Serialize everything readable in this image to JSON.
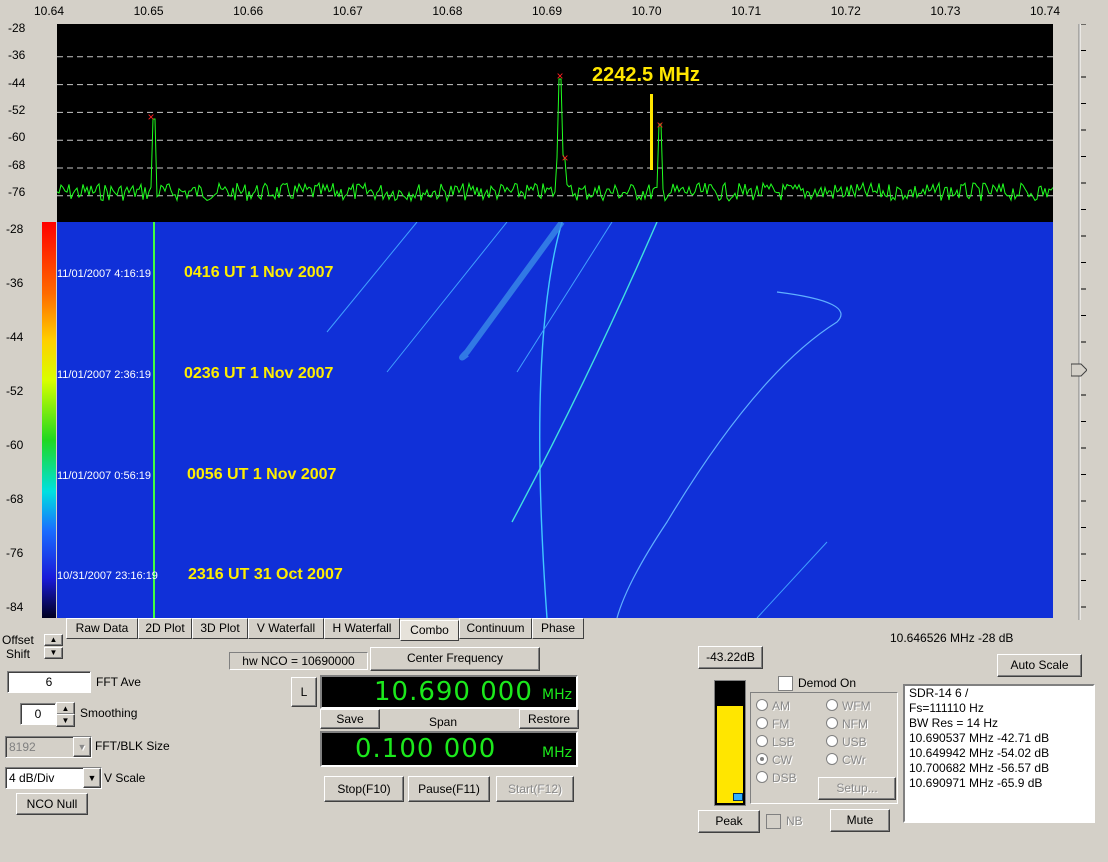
{
  "freq_axis": [
    "10.64",
    "10.65",
    "10.66",
    "10.67",
    "10.68",
    "10.69",
    "10.70",
    "10.71",
    "10.72",
    "10.73",
    "10.74"
  ],
  "spectrum_yaxis": [
    "-28",
    "-36",
    "-44",
    "-52",
    "-60",
    "-68",
    "-76"
  ],
  "waterfall_yaxis": [
    "-28",
    "-36",
    "-44",
    "-52",
    "-60",
    "-68",
    "-76",
    "-84"
  ],
  "spectrum_annotation": "2242.5 MHz",
  "waterfall": {
    "stamps": [
      {
        "time": "11/01/2007 4:16:19",
        "note": "0416 UT 1 Nov 2007"
      },
      {
        "time": "11/01/2007 2:36:19",
        "note": "0236 UT 1 Nov 2007"
      },
      {
        "time": "11/01/2007 0:56:19",
        "note": "0056 UT 1 Nov 2007"
      },
      {
        "time": "10/31/2007 23:16:19",
        "note": "2316 UT 31 Oct 2007"
      }
    ]
  },
  "tabs": [
    "Raw Data",
    "2D Plot",
    "3D Plot",
    "V Waterfall",
    "H Waterfall",
    "Combo",
    "Continuum",
    "Phase"
  ],
  "active_tab": "Combo",
  "offset_label": "Offset",
  "shift_label": "Shift",
  "fft_ave": {
    "value": "6",
    "label": "FFT Ave"
  },
  "smoothing": {
    "value": "0",
    "label": "Smoothing"
  },
  "fft_blk": {
    "value": "8192",
    "label": "FFT/BLK Size"
  },
  "vscale": {
    "value": "4 dB/Div",
    "label": "V Scale"
  },
  "nco_null": "NCO Null",
  "hw_nco": "hw NCO = 10690000",
  "center_freq_btn": "Center Frequency",
  "l_btn": "L",
  "center_freq_value": "10.690 000",
  "freq_unit": "MHz",
  "save_btn": "Save",
  "span_label": "Span",
  "restore_btn": "Restore",
  "span_value": "0.100 000",
  "stop_btn": "Stop(F10)",
  "pause_btn": "Pause(F11)",
  "start_btn": "Start(F12)",
  "cursor_readout": "10.646526 MHz  -28 dB",
  "auto_scale": "Auto Scale",
  "level_btn": "-43.22dB",
  "level_fraction": 0.78,
  "demod_on": "Demod On",
  "modes_left": [
    "AM",
    "FM",
    "LSB",
    "CW",
    "DSB"
  ],
  "modes_right": [
    "WFM",
    "NFM",
    "USB",
    "CWr"
  ],
  "selected_mode": "CW",
  "setup_btn": "Setup...",
  "peak_btn": "Peak",
  "nb_label": "NB",
  "mute_btn": "Mute",
  "info": [
    "SDR-14 6  /",
    "Fs=111110 Hz",
    "BW Res =  14 Hz",
    " 10.690537 MHz  -42.71 dB",
    " 10.649942 MHz  -54.02 dB",
    " 10.700682 MHz  -56.57 dB",
    " 10.690971 MHz  -65.9 dB"
  ]
}
